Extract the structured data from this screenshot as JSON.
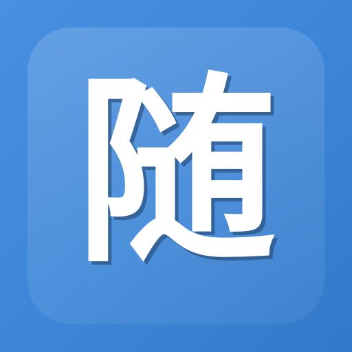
{
  "icon": {
    "glyph": "随",
    "background_color": "#3d86d8",
    "glyph_color": "#ffffff",
    "shadow_color": "#1f3f66"
  }
}
